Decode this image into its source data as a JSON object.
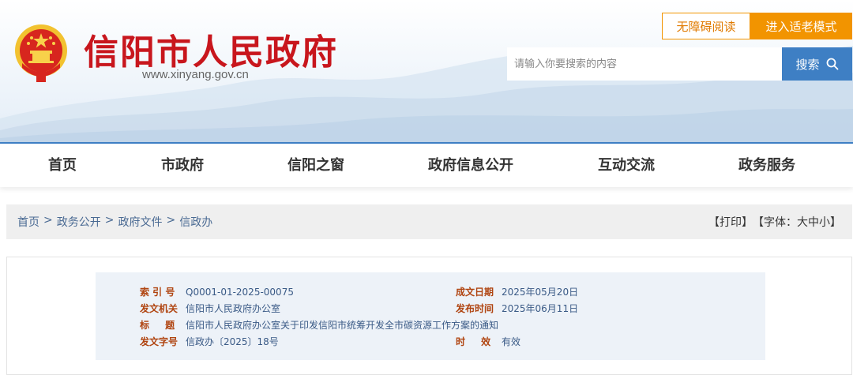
{
  "header": {
    "site_name": "信阳市人民政府",
    "site_url": "www.xinyang.gov.cn",
    "accessibility_label": "无障碍阅读",
    "elder_mode_label": "进入适老模式",
    "search_placeholder": "请输入你要搜索的内容",
    "search_button": "搜索"
  },
  "nav": {
    "items": [
      {
        "label": "首页"
      },
      {
        "label": "市政府"
      },
      {
        "label": "信阳之窗"
      },
      {
        "label": "政府信息公开"
      },
      {
        "label": "互动交流"
      },
      {
        "label": "政务服务"
      }
    ]
  },
  "breadcrumb": {
    "items": [
      "首页",
      "政务公开",
      "政府文件",
      "信政办"
    ],
    "separator": ">"
  },
  "tools": {
    "print": "【打印】",
    "font_prefix": "【字体：",
    "font_large": "大",
    "font_medium": "中",
    "font_small": "小",
    "font_suffix": "】"
  },
  "document_meta": {
    "index_label": "索 引 号",
    "index_value": "Q0001-01-2025-00075",
    "created_label": "成文日期",
    "created_value": "2025年05月20日",
    "issuer_label": "发文机关",
    "issuer_value": "信阳市人民政府办公室",
    "published_label": "发布时间",
    "published_value": "2025年06月11日",
    "title_label": "标 题",
    "title_value": "信阳市人民政府办公室关于印发信阳市统筹开发全市碳资源工作方案的通知",
    "doc_no_label": "发文字号",
    "doc_no_value": "信政办〔2025〕18号",
    "validity_label": "时 效",
    "validity_value": "有效"
  },
  "colors": {
    "brand_red": "#c8161d",
    "accent_orange": "#f29400",
    "accent_blue": "#3e7fc4",
    "meta_label": "#b04410",
    "meta_value": "#3a5a86"
  },
  "icons": {
    "emblem": "national-emblem-icon",
    "search": "search-icon"
  }
}
